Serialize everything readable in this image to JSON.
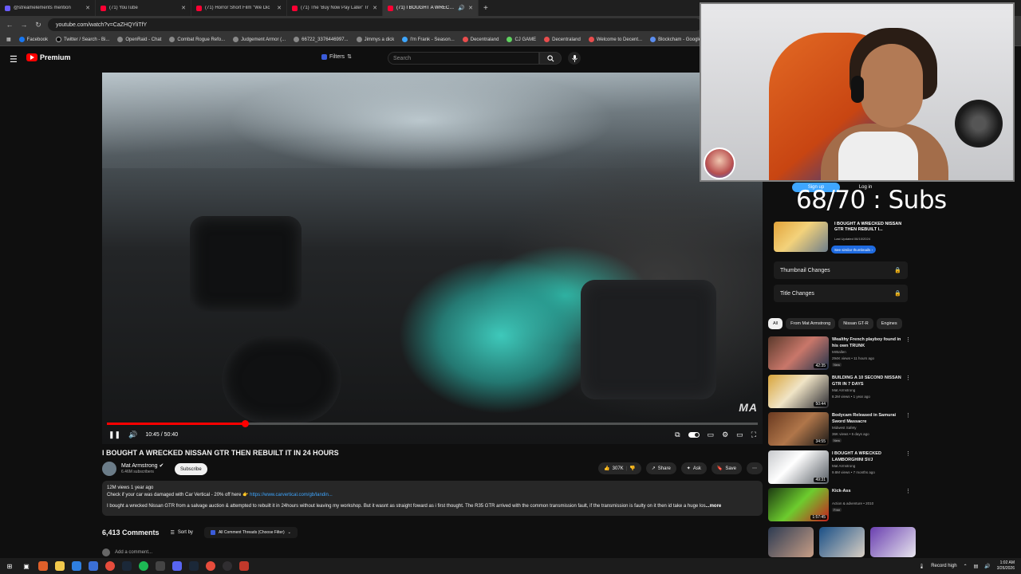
{
  "browser": {
    "tabs": [
      {
        "title": "@streamelements mention",
        "favicon": "streamelements-icon",
        "active": false
      },
      {
        "title": "(71) YouTube",
        "favicon": "youtube-icon",
        "active": false
      },
      {
        "title": "(71) Horror Short Film \"We Dic",
        "favicon": "youtube-icon",
        "active": false
      },
      {
        "title": "(71) The 'Buy Now Pay Later' Tr",
        "favicon": "youtube-icon",
        "active": false
      },
      {
        "title": "(71) I BOUGHT A WRECKED",
        "favicon": "youtube-icon",
        "active": true
      }
    ],
    "url": "youtube.com/watch?v=CaZHQYliTfY",
    "bookmarks": [
      "Facebook",
      "Twitter / Search - Bi...",
      "OpenRaid - Chat",
      "Combat Rogue Refo...",
      "Judgement Armor (...",
      "66722_3376446997...",
      "Jimmys a dick",
      "I'm Frank - Season...",
      "Decentraland",
      "CJ GAME",
      "Decentraland",
      "Welcome to Decent...",
      "Blockcham - Google..."
    ]
  },
  "yt": {
    "brand": "Premium",
    "filters_label": "Filters",
    "search_placeholder": "Search"
  },
  "player": {
    "time": "10:45 / 50:40",
    "progress": 0.2122,
    "watermark": "MA"
  },
  "video": {
    "title": "I BOUGHT A WRECKED NISSAN GTR THEN REBUILT IT IN 24 HOURS",
    "channel": "Mat Armstrong",
    "subscribers": "6.46M subscribers",
    "subscribe_label": "Subscribe",
    "likes": "307K",
    "share_label": "Share",
    "ask_label": "Ask",
    "save_label": "Save",
    "description": {
      "stats": "12M views  1 year ago",
      "line2": "Check if your car was damaged with Car Vertical - 20% off here 👉",
      "link": "https://www.carvertical.com/gb/landin...",
      "line3": "I bought a wrecked Nissan GTR from a salvage auction & attempted to rebuilt it in 24hours without leaving my workshop. But it wasnt as straight foward as i first thought. The R35 GTR arrived with the common transmission fault, if the transmission is faulty on it then id take a huge los",
      "more": "...more"
    }
  },
  "comments": {
    "count": "6,413 Comments",
    "sort_label": "Sort by",
    "threads_label": "All Comment Threads (Choose Filter)",
    "add_placeholder": "Add a comment..."
  },
  "sidebar": {
    "signup": "Sign up",
    "login": "Log in",
    "overlay_subs": "68/70 : Subs",
    "ext": {
      "title": "I BOUGHT A WRECKED NISSAN GTR THEN REBUILT I...",
      "date": "Last Updated 06/10/2024",
      "button": "See similar thumbnails"
    },
    "thumbnail_changes": "Thumbnail Changes",
    "title_changes": "Title Changes",
    "chips": [
      "All",
      "From Mat Armstrong",
      "Nissan GT-R",
      "Engines"
    ],
    "recs": [
      {
        "title": "Wealthy French playboy found in his own TRUNK",
        "channel": "MrBallen",
        "meta": "294K views • 11 hours ago",
        "badge": "New",
        "duration": "42:35"
      },
      {
        "title": "BUILDING A 10 SECOND NISSAN GTR IN 7 DAYS",
        "channel": "Mat Armstrong",
        "meta": "8.2M views • 1 year ago",
        "badge": "",
        "duration": "50:44"
      },
      {
        "title": "Bodycam Released in Samurai Sword Massacre",
        "channel": "Midwest Safety",
        "meta": "36K views • 5 days ago",
        "badge": "New",
        "duration": "34:55"
      },
      {
        "title": "I BOUGHT A WRECKED LAMBORGHINI SVJ",
        "channel": "Mat Armstrong",
        "meta": "9.8M views • 7 months ago",
        "badge": "",
        "duration": "49:31"
      },
      {
        "title": "Kick-Ass",
        "channel": "Action & adventure • 2010",
        "meta": "",
        "badge": "Free",
        "duration": "1:57:45"
      }
    ]
  },
  "taskbar": {
    "record": "Record high",
    "time": "1:02 AM",
    "date": "3/26/2026"
  }
}
